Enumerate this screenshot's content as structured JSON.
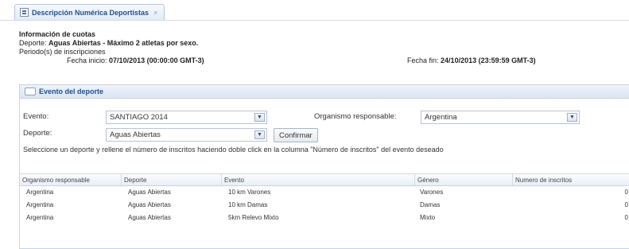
{
  "tab": {
    "title": "Descripción Numérica Deportistas",
    "close_glyph": "×",
    "icon": "document-icon"
  },
  "info": {
    "heading": "Información de cuotas",
    "deporte_label": "Deporte:",
    "deporte_value": "Aguas Abiertas - Máximo 2 atletas por sexo.",
    "periodo_label": "Periodo(s) de inscripciones",
    "fecha_inicio_label": "Fecha inicio:",
    "fecha_inicio_value": "07/10/2013 (00:00:00 GMT-3)",
    "fecha_fin_label": "Fecha fin:",
    "fecha_fin_value": "24/10/2013 (23:59:59 GMT-3)"
  },
  "panel": {
    "title": "Evento del deporte",
    "evento_label": "Evento:",
    "evento_value": "SANTIAGO 2014",
    "organismo_label": "Organismo responsable:",
    "organismo_value": "Argentina",
    "deporte_label": "Deporte:",
    "deporte_value": "Aguas Abiertas",
    "confirm_label": "Confirmar",
    "hint": "Seleccione un deporte y rellene el número de inscritos haciendo doble click en la columna \"Número de inscritos\" del evento deseado"
  },
  "table": {
    "columns": [
      "Organismo responsable",
      "Deporte",
      "Evento",
      "Género",
      "Numero de inscritos"
    ],
    "rows": [
      [
        "Argentina",
        "Aguas Abiertas",
        "10 km Varones",
        "Varones",
        "0"
      ],
      [
        "Argentina",
        "Aguas Abiertas",
        "10 km Damas",
        "Damas",
        "0"
      ],
      [
        "Argentina",
        "Aguas Abiertas",
        "5km Relevo Mixto",
        "Mixto",
        "0"
      ]
    ]
  }
}
